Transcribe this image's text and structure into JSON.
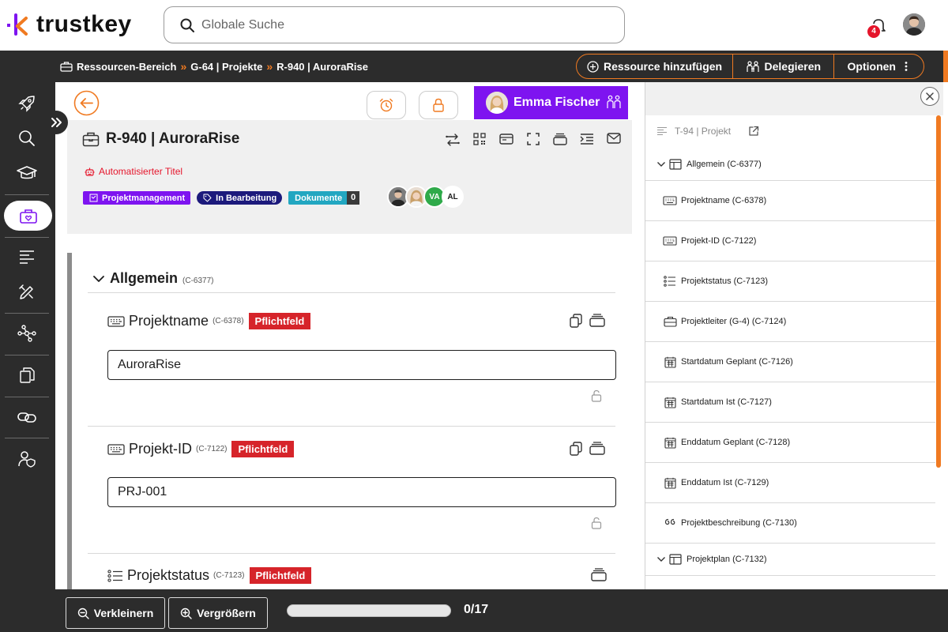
{
  "app": {
    "logo_text": "trustkey"
  },
  "search": {
    "placeholder": "Globale Suche"
  },
  "notifications": {
    "count": "4"
  },
  "breadcrumb": {
    "items": [
      "Ressourcen-Bereich",
      "G-64 | Projekte",
      "R-940 | AuroraRise"
    ]
  },
  "actions": {
    "add_resource": "Ressource hinzufügen",
    "delegate": "Delegieren",
    "options": "Optionen"
  },
  "record": {
    "title": "R-940 | AuroraRise",
    "assignee": "Emma Fischer",
    "auto_title": "Automatisierter Titel",
    "tags": {
      "category": "Projektmanagement",
      "status": "In Bearbeitung",
      "documents_label": "Dokumente",
      "documents_count": "0"
    },
    "participants": [
      "VA",
      "AL"
    ]
  },
  "section": {
    "title": "Allgemein",
    "code": "(C-6377)",
    "fields": [
      {
        "label": "Projektname",
        "code": "(C-6378)",
        "badge": "Pflichtfeld",
        "value": "AuroraRise"
      },
      {
        "label": "Projekt-ID",
        "code": "(C-7122)",
        "badge": "Pflichtfeld",
        "value": "PRJ-001"
      },
      {
        "label": "Projektstatus",
        "code": "(C-7123)",
        "badge": "Pflichtfeld",
        "value": ""
      }
    ]
  },
  "right_panel": {
    "header": "T-94 | Projekt",
    "rows": [
      {
        "kind": "group",
        "icon": "table-icon",
        "label": "Allgemein (C-6377)"
      },
      {
        "kind": "item",
        "icon": "keyboard-icon",
        "label": "Projektname (C-6378)"
      },
      {
        "kind": "item",
        "icon": "keyboard-icon",
        "label": "Projekt-ID (C-7122)"
      },
      {
        "kind": "item",
        "icon": "list-icon",
        "label": "Projektstatus (C-7123)"
      },
      {
        "kind": "item",
        "icon": "briefcase-icon",
        "label": "Projektleiter (G-4) (C-7124)"
      },
      {
        "kind": "item",
        "icon": "calendar-icon",
        "label": "Startdatum Geplant (C-7126)"
      },
      {
        "kind": "item",
        "icon": "calendar-icon",
        "label": "Startdatum Ist (C-7127)"
      },
      {
        "kind": "item",
        "icon": "calendar-icon",
        "label": "Enddatum Geplant (C-7128)"
      },
      {
        "kind": "item",
        "icon": "calendar-icon",
        "label": "Enddatum Ist (C-7129)"
      },
      {
        "kind": "item",
        "icon": "quote-icon",
        "label": "Projektbeschreibung (C-7130)"
      },
      {
        "kind": "group",
        "icon": "table-icon",
        "label": "Projektplan (C-7132)"
      }
    ]
  },
  "footer": {
    "zoom_out": "Verkleinern",
    "zoom_in": "Vergrößern",
    "progress_value": 0,
    "progress_total": 17,
    "progress_label": "0/17"
  },
  "colors": {
    "accent": "#f07a21",
    "brand_purple": "#7e14f0",
    "required_red": "#d6242a",
    "dark_bar": "#2c2c2c"
  }
}
